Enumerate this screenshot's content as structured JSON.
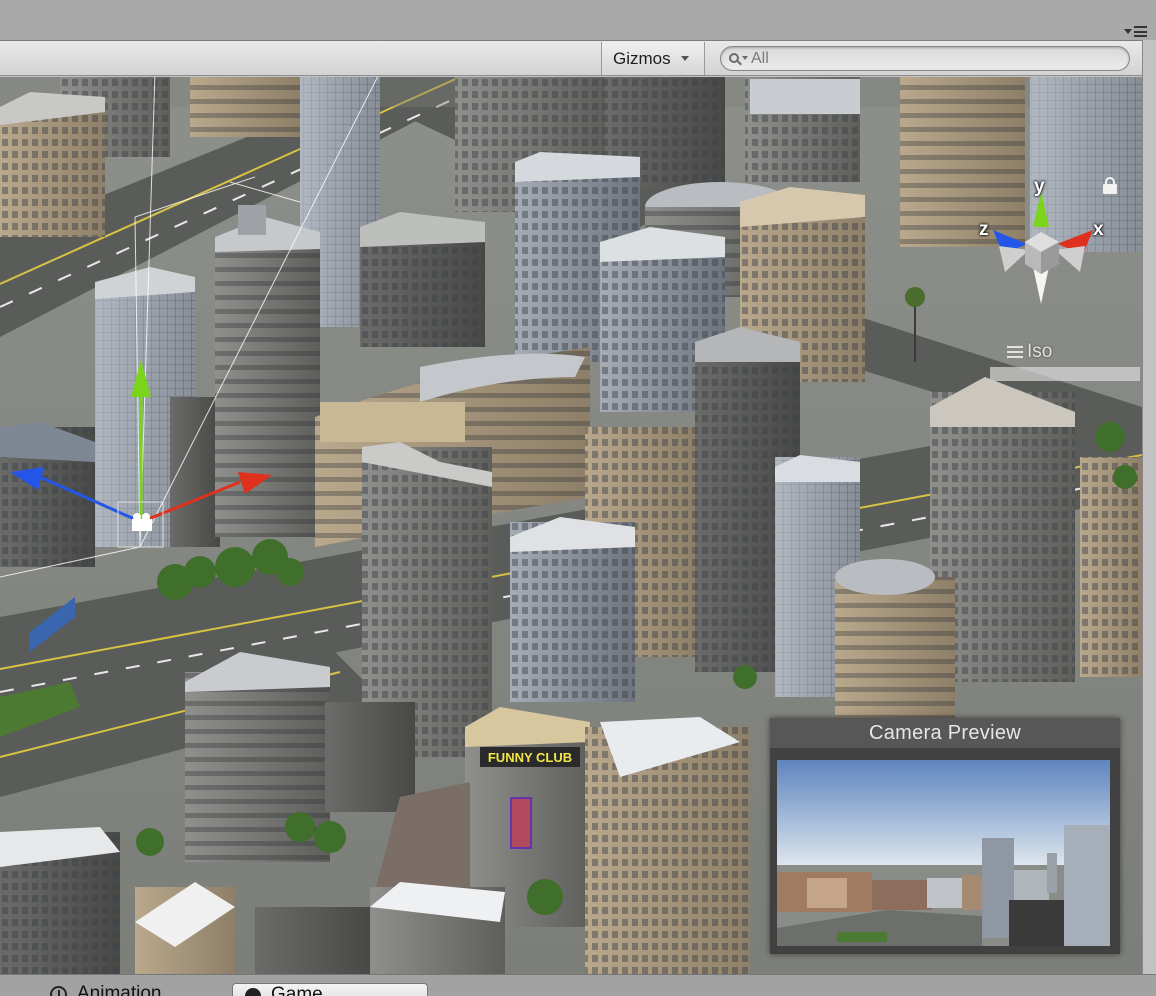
{
  "toolbar": {
    "gizmos_label": "Gizmos",
    "search_placeholder": "All"
  },
  "scene": {
    "orientation_gizmo": {
      "axis_y_label": "y",
      "axis_x_label": "x",
      "axis_z_label": "z",
      "projection_label": "Iso",
      "colors": {
        "x": "#e0301e",
        "y": "#7ad41c",
        "z": "#2456e8"
      }
    },
    "signage": {
      "club_sign": "FUNNY CLUB"
    }
  },
  "camera_preview": {
    "title": "Camera Preview"
  },
  "bottom_tabs": [
    {
      "label": "Animation",
      "icon": "clock-icon"
    },
    {
      "label": "Game",
      "icon": "game-icon"
    }
  ]
}
